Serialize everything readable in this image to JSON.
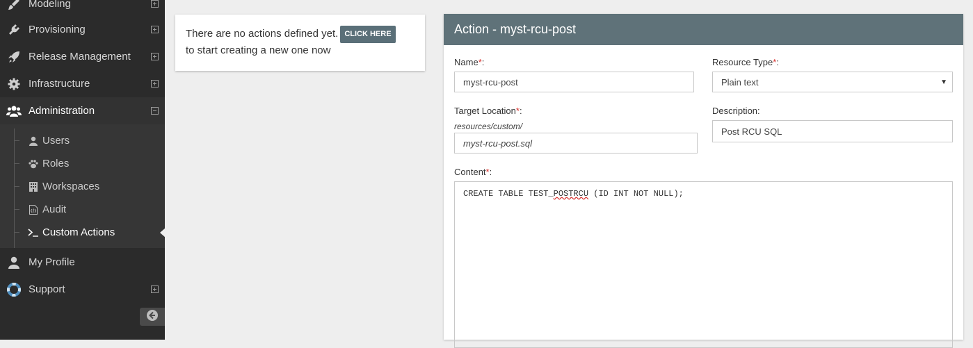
{
  "sidebar": {
    "items": [
      {
        "label": "Modeling",
        "icon": "brush-icon",
        "toggle": "expand"
      },
      {
        "label": "Provisioning",
        "icon": "plug-icon",
        "toggle": "expand"
      },
      {
        "label": "Release Management",
        "icon": "rocket-icon",
        "toggle": "expand"
      },
      {
        "label": "Infrastructure",
        "icon": "gear-icon",
        "toggle": "expand"
      },
      {
        "label": "Administration",
        "icon": "users-icon",
        "toggle": "collapse"
      },
      {
        "label": "My Profile",
        "icon": "user-icon"
      },
      {
        "label": "Support",
        "icon": "lifebuoy-icon",
        "toggle": "expand"
      }
    ],
    "submenu": [
      {
        "label": "Users",
        "icon": "user-icon"
      },
      {
        "label": "Roles",
        "icon": "paw-icon"
      },
      {
        "label": "Workspaces",
        "icon": "building-icon"
      },
      {
        "label": "Audit",
        "icon": "code-file-icon"
      },
      {
        "label": "Custom Actions",
        "icon": "terminal-icon"
      }
    ]
  },
  "info": {
    "text_before": "There are no actions defined yet.",
    "click_here": "CLICK HERE",
    "text_after": "to start creating a new one now"
  },
  "form": {
    "title": "Action - myst-rcu-post",
    "name_label": "Name",
    "name_value": "myst-rcu-post",
    "resource_type_label": "Resource Type",
    "resource_type_value": "Plain text",
    "target_location_label": "Target Location",
    "target_location_prefix": "resources/custom/",
    "target_location_value": "myst-rcu-post.sql",
    "description_label": "Description:",
    "description_value": "Post RCU SQL",
    "content_label": "Content",
    "content_parts": [
      "CREATE TABLE TEST_",
      "POSTRCU",
      " (ID INT NOT NULL);"
    ]
  },
  "colors": {
    "sidebar_bg": "#2b2b2b",
    "panel_header": "#5f7279",
    "required": "#d9302c",
    "accent_button": "#5a6f78"
  }
}
